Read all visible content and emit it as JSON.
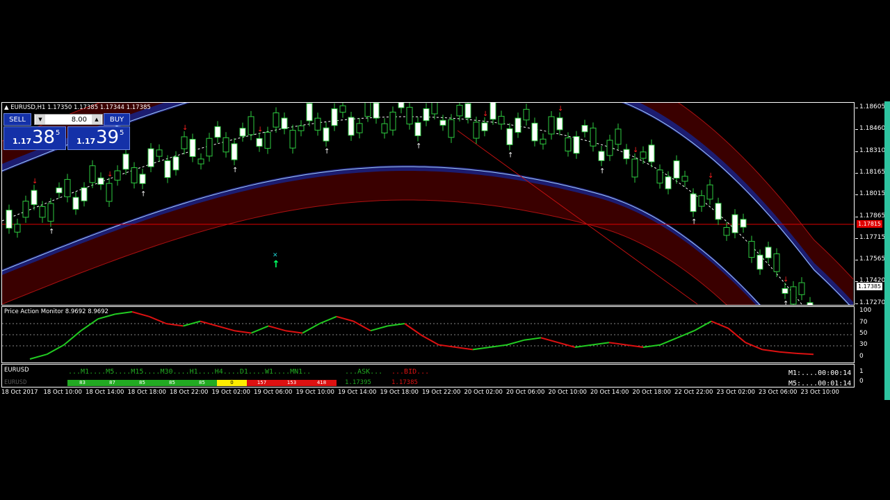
{
  "chart": {
    "symbol_header": "EURUSD,H1  1.17350 1.17385 1.17344 1.17385",
    "price_scale": [
      "1.18605",
      "1.18460",
      "1.18310",
      "1.18165",
      "1.18015",
      "1.17865",
      "1.17715",
      "1.17565",
      "1.17420",
      "1.17270"
    ],
    "bid_tag": "1.17385",
    "line_tag": "1.17815"
  },
  "trade_panel": {
    "sell_label": "SELL",
    "buy_label": "BUY",
    "lot_value": "8.00",
    "bid_prefix": "1.17",
    "bid_big": "38",
    "bid_sup": "5",
    "ask_prefix": "1.17",
    "ask_big": "39",
    "ask_sup": "5"
  },
  "indicator": {
    "title": "Price Action Monitor 8.9692 8.9692",
    "scale": [
      "100",
      "70",
      "50",
      "30",
      "0"
    ]
  },
  "monitor": {
    "symbol": "EURUSD",
    "header": "...M1....M5....M15....M30....H1....H4....D1....W1....MN1..",
    "ask_label": "...ASK...",
    "bid_label": "...BID...",
    "row_symbol": "EURUSD",
    "cells": [
      "83",
      "87",
      "85",
      "85",
      "85",
      "0",
      "157",
      "153",
      "418"
    ],
    "ask_value": "1.17395",
    "bid_value": "1.17385",
    "timer_m1": "M1:....00:00:14",
    "timer_m5": "M5:....00:01:14",
    "scale": [
      "1",
      "0"
    ]
  },
  "time_axis": [
    "18 Oct 2017",
    "18 Oct 10:00",
    "18 Oct 14:00",
    "18 Oct 18:00",
    "18 Oct 22:00",
    "19 Oct 02:00",
    "19 Oct 06:00",
    "19 Oct 10:00",
    "19 Oct 14:00",
    "19 Oct 18:00",
    "19 Oct 22:00",
    "20 Oct 02:00",
    "20 Oct 06:00",
    "20 Oct 10:00",
    "20 Oct 14:00",
    "20 Oct 18:00",
    "22 Oct 22:00",
    "23 Oct 02:00",
    "23 Oct 06:00",
    "23 Oct 10:00"
  ],
  "colors": {
    "channel": "#3a0000",
    "blue_band": "#1c1c70",
    "up": "#ffffff",
    "down": "#000000",
    "sell_arrow": "#ff2020",
    "buy_arrow": "#00ff60",
    "ind_up": "#22cc22",
    "ind_down": "#dd1111"
  }
}
